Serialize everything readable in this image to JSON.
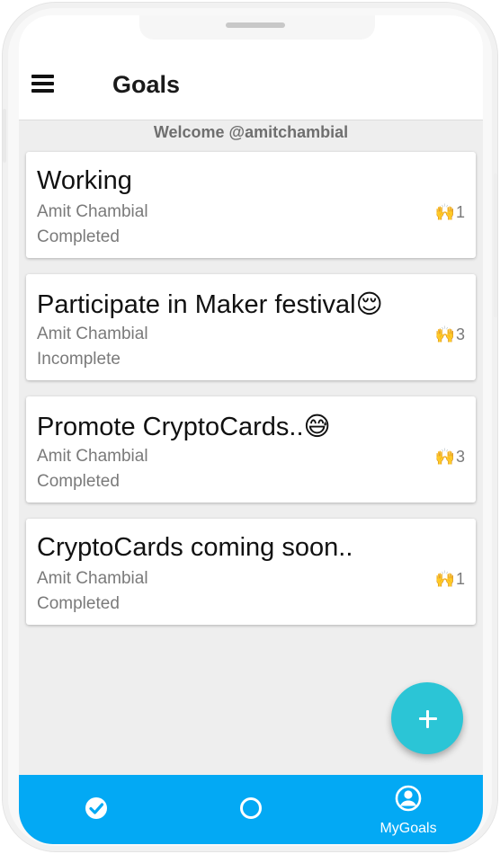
{
  "header": {
    "title": "Goals"
  },
  "welcome": "Welcome @amitchambial",
  "goals": [
    {
      "title": "Working",
      "author": "Amit Chambial",
      "status": "Completed",
      "likes": "1"
    },
    {
      "title": "Participate in Maker festival😌",
      "author": "Amit Chambial",
      "status": "Incomplete",
      "likes": "3"
    },
    {
      "title": "Promote CryptoCards..😅",
      "author": "Amit Chambial",
      "status": "Completed",
      "likes": "3"
    },
    {
      "title": "CryptoCards coming soon..",
      "author": "Amit Chambial",
      "status": "Completed",
      "likes": "1"
    }
  ],
  "clap_emoji": "🙌",
  "fab": {
    "icon": "plus-icon",
    "color": "#2bc5d6"
  },
  "bottom_nav": {
    "background": "#03a9f4",
    "items": [
      {
        "icon": "check-circle-icon",
        "label": ""
      },
      {
        "icon": "circle-icon",
        "label": ""
      },
      {
        "icon": "account-circle-icon",
        "label": "MyGoals"
      }
    ]
  }
}
